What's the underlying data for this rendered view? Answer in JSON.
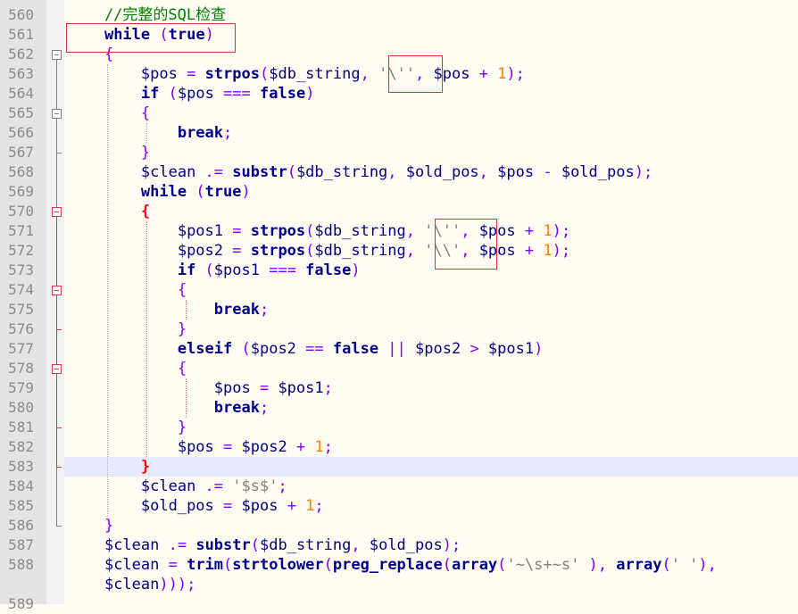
{
  "editor": {
    "lines": [
      {
        "num": "560",
        "segments": [
          {
            "t": "    //完整的SQL检查",
            "c": "cm"
          }
        ]
      },
      {
        "num": "561",
        "segments": [
          {
            "t": "    ",
            "c": ""
          },
          {
            "t": "while",
            "c": "kw"
          },
          {
            "t": " (",
            "c": "op"
          },
          {
            "t": "true",
            "c": "kw"
          },
          {
            "t": ")",
            "c": "op"
          }
        ]
      },
      {
        "num": "562",
        "segments": [
          {
            "t": "    ",
            "c": ""
          },
          {
            "t": "{",
            "c": "brace"
          }
        ]
      },
      {
        "num": "563",
        "segments": [
          {
            "t": "        ",
            "c": ""
          },
          {
            "t": "$pos",
            "c": "var"
          },
          {
            "t": " = ",
            "c": "op"
          },
          {
            "t": "strpos",
            "c": "fn"
          },
          {
            "t": "(",
            "c": "op"
          },
          {
            "t": "$db_string",
            "c": "var"
          },
          {
            "t": ", ",
            "c": "op"
          },
          {
            "t": "'\\''",
            "c": "str"
          },
          {
            "t": ", ",
            "c": "op"
          },
          {
            "t": "$pos",
            "c": "var"
          },
          {
            "t": " + ",
            "c": "op"
          },
          {
            "t": "1",
            "c": "num"
          },
          {
            "t": ");",
            "c": "op"
          }
        ]
      },
      {
        "num": "564",
        "segments": [
          {
            "t": "        ",
            "c": ""
          },
          {
            "t": "if",
            "c": "kw"
          },
          {
            "t": " (",
            "c": "op"
          },
          {
            "t": "$pos",
            "c": "var"
          },
          {
            "t": " === ",
            "c": "op"
          },
          {
            "t": "false",
            "c": "kw"
          },
          {
            "t": ")",
            "c": "op"
          }
        ]
      },
      {
        "num": "565",
        "segments": [
          {
            "t": "        ",
            "c": ""
          },
          {
            "t": "{",
            "c": "brace"
          }
        ]
      },
      {
        "num": "566",
        "segments": [
          {
            "t": "            ",
            "c": ""
          },
          {
            "t": "break",
            "c": "kw"
          },
          {
            "t": ";",
            "c": "op"
          }
        ]
      },
      {
        "num": "567",
        "segments": [
          {
            "t": "        ",
            "c": ""
          },
          {
            "t": "}",
            "c": "brace"
          }
        ]
      },
      {
        "num": "568",
        "segments": [
          {
            "t": "        ",
            "c": ""
          },
          {
            "t": "$clean",
            "c": "var"
          },
          {
            "t": " .= ",
            "c": "op"
          },
          {
            "t": "substr",
            "c": "fn"
          },
          {
            "t": "(",
            "c": "op"
          },
          {
            "t": "$db_string",
            "c": "var"
          },
          {
            "t": ", ",
            "c": "op"
          },
          {
            "t": "$old_pos",
            "c": "var"
          },
          {
            "t": ", ",
            "c": "op"
          },
          {
            "t": "$pos",
            "c": "var"
          },
          {
            "t": " - ",
            "c": "op"
          },
          {
            "t": "$old_pos",
            "c": "var"
          },
          {
            "t": ");",
            "c": "op"
          }
        ]
      },
      {
        "num": "569",
        "segments": [
          {
            "t": "        ",
            "c": ""
          },
          {
            "t": "while",
            "c": "kw"
          },
          {
            "t": " (",
            "c": "op"
          },
          {
            "t": "true",
            "c": "kw"
          },
          {
            "t": ")",
            "c": "op"
          }
        ]
      },
      {
        "num": "570",
        "segments": [
          {
            "t": "        ",
            "c": ""
          },
          {
            "t": "{",
            "c": "bracehl"
          }
        ]
      },
      {
        "num": "571",
        "segments": [
          {
            "t": "            ",
            "c": ""
          },
          {
            "t": "$pos1",
            "c": "var"
          },
          {
            "t": " = ",
            "c": "op"
          },
          {
            "t": "strpos",
            "c": "fn"
          },
          {
            "t": "(",
            "c": "op"
          },
          {
            "t": "$db_string",
            "c": "var"
          },
          {
            "t": ", ",
            "c": "op"
          },
          {
            "t": "'\\''",
            "c": "str"
          },
          {
            "t": ", ",
            "c": "op"
          },
          {
            "t": "$pos",
            "c": "var"
          },
          {
            "t": " + ",
            "c": "op"
          },
          {
            "t": "1",
            "c": "num"
          },
          {
            "t": ");",
            "c": "op"
          }
        ]
      },
      {
        "num": "572",
        "segments": [
          {
            "t": "            ",
            "c": ""
          },
          {
            "t": "$pos2",
            "c": "var"
          },
          {
            "t": " = ",
            "c": "op"
          },
          {
            "t": "strpos",
            "c": "fn"
          },
          {
            "t": "(",
            "c": "op"
          },
          {
            "t": "$db_string",
            "c": "var"
          },
          {
            "t": ", ",
            "c": "op"
          },
          {
            "t": "'\\\\'",
            "c": "str"
          },
          {
            "t": ", ",
            "c": "op"
          },
          {
            "t": "$pos",
            "c": "var"
          },
          {
            "t": " + ",
            "c": "op"
          },
          {
            "t": "1",
            "c": "num"
          },
          {
            "t": ");",
            "c": "op"
          }
        ]
      },
      {
        "num": "573",
        "segments": [
          {
            "t": "            ",
            "c": ""
          },
          {
            "t": "if",
            "c": "kw"
          },
          {
            "t": " (",
            "c": "op"
          },
          {
            "t": "$pos1",
            "c": "var"
          },
          {
            "t": " === ",
            "c": "op"
          },
          {
            "t": "false",
            "c": "kw"
          },
          {
            "t": ")",
            "c": "op"
          }
        ]
      },
      {
        "num": "574",
        "segments": [
          {
            "t": "            ",
            "c": ""
          },
          {
            "t": "{",
            "c": "brace"
          }
        ]
      },
      {
        "num": "575",
        "segments": [
          {
            "t": "                ",
            "c": ""
          },
          {
            "t": "break",
            "c": "kw"
          },
          {
            "t": ";",
            "c": "op"
          }
        ]
      },
      {
        "num": "576",
        "segments": [
          {
            "t": "            ",
            "c": ""
          },
          {
            "t": "}",
            "c": "brace"
          }
        ]
      },
      {
        "num": "577",
        "segments": [
          {
            "t": "            ",
            "c": ""
          },
          {
            "t": "elseif",
            "c": "kw"
          },
          {
            "t": " (",
            "c": "op"
          },
          {
            "t": "$pos2",
            "c": "var"
          },
          {
            "t": " == ",
            "c": "op"
          },
          {
            "t": "false",
            "c": "kw"
          },
          {
            "t": " || ",
            "c": "op"
          },
          {
            "t": "$pos2",
            "c": "var"
          },
          {
            "t": " > ",
            "c": "op"
          },
          {
            "t": "$pos1",
            "c": "var"
          },
          {
            "t": ")",
            "c": "op"
          }
        ]
      },
      {
        "num": "578",
        "segments": [
          {
            "t": "            ",
            "c": ""
          },
          {
            "t": "{",
            "c": "brace"
          }
        ]
      },
      {
        "num": "579",
        "segments": [
          {
            "t": "                ",
            "c": ""
          },
          {
            "t": "$pos",
            "c": "var"
          },
          {
            "t": " = ",
            "c": "op"
          },
          {
            "t": "$pos1",
            "c": "var"
          },
          {
            "t": ";",
            "c": "op"
          }
        ]
      },
      {
        "num": "580",
        "segments": [
          {
            "t": "                ",
            "c": ""
          },
          {
            "t": "break",
            "c": "kw"
          },
          {
            "t": ";",
            "c": "op"
          }
        ]
      },
      {
        "num": "581",
        "segments": [
          {
            "t": "            ",
            "c": ""
          },
          {
            "t": "}",
            "c": "brace"
          }
        ]
      },
      {
        "num": "582",
        "segments": [
          {
            "t": "            ",
            "c": ""
          },
          {
            "t": "$pos",
            "c": "var"
          },
          {
            "t": " = ",
            "c": "op"
          },
          {
            "t": "$pos2",
            "c": "var"
          },
          {
            "t": " + ",
            "c": "op"
          },
          {
            "t": "1",
            "c": "num"
          },
          {
            "t": ";",
            "c": "op"
          }
        ]
      },
      {
        "num": "583",
        "segments": [
          {
            "t": "        ",
            "c": ""
          },
          {
            "t": "}",
            "c": "bracehl"
          }
        ]
      },
      {
        "num": "584",
        "segments": [
          {
            "t": "        ",
            "c": ""
          },
          {
            "t": "$clean",
            "c": "var"
          },
          {
            "t": " .= ",
            "c": "op"
          },
          {
            "t": "'$s$'",
            "c": "str"
          },
          {
            "t": ";",
            "c": "op"
          }
        ]
      },
      {
        "num": "585",
        "segments": [
          {
            "t": "        ",
            "c": ""
          },
          {
            "t": "$old_pos",
            "c": "var"
          },
          {
            "t": " = ",
            "c": "op"
          },
          {
            "t": "$pos",
            "c": "var"
          },
          {
            "t": " + ",
            "c": "op"
          },
          {
            "t": "1",
            "c": "num"
          },
          {
            "t": ";",
            "c": "op"
          }
        ]
      },
      {
        "num": "586",
        "segments": [
          {
            "t": "    ",
            "c": ""
          },
          {
            "t": "}",
            "c": "brace"
          }
        ]
      },
      {
        "num": "587",
        "segments": [
          {
            "t": "    ",
            "c": ""
          },
          {
            "t": "$clean",
            "c": "var"
          },
          {
            "t": " .= ",
            "c": "op"
          },
          {
            "t": "substr",
            "c": "fn"
          },
          {
            "t": "(",
            "c": "op"
          },
          {
            "t": "$db_string",
            "c": "var"
          },
          {
            "t": ", ",
            "c": "op"
          },
          {
            "t": "$old_pos",
            "c": "var"
          },
          {
            "t": ");",
            "c": "op"
          }
        ]
      },
      {
        "num": "588",
        "segments": [
          {
            "t": "    ",
            "c": ""
          },
          {
            "t": "$clean",
            "c": "var"
          },
          {
            "t": " = ",
            "c": "op"
          },
          {
            "t": "trim",
            "c": "fn"
          },
          {
            "t": "(",
            "c": "op"
          },
          {
            "t": "strtolower",
            "c": "fn"
          },
          {
            "t": "(",
            "c": "op"
          },
          {
            "t": "preg_replace",
            "c": "fn"
          },
          {
            "t": "(",
            "c": "op"
          },
          {
            "t": "array",
            "c": "kw"
          },
          {
            "t": "(",
            "c": "op"
          },
          {
            "t": "'~\\s+~s'",
            "c": "str"
          },
          {
            "t": " ), ",
            "c": "op"
          },
          {
            "t": "array",
            "c": "kw"
          },
          {
            "t": "(",
            "c": "op"
          },
          {
            "t": "' '",
            "c": "str"
          },
          {
            "t": "),",
            "c": "op"
          }
        ]
      },
      {
        "num": "",
        "segments": [
          {
            "t": "    ",
            "c": ""
          },
          {
            "t": "$clean",
            "c": "var"
          },
          {
            "t": ")));",
            "c": "op"
          }
        ]
      },
      {
        "num": "589",
        "segments": []
      }
    ],
    "current_line_index": 23,
    "fold_markers": [
      "561",
      "564",
      "569",
      "573",
      "577"
    ]
  }
}
